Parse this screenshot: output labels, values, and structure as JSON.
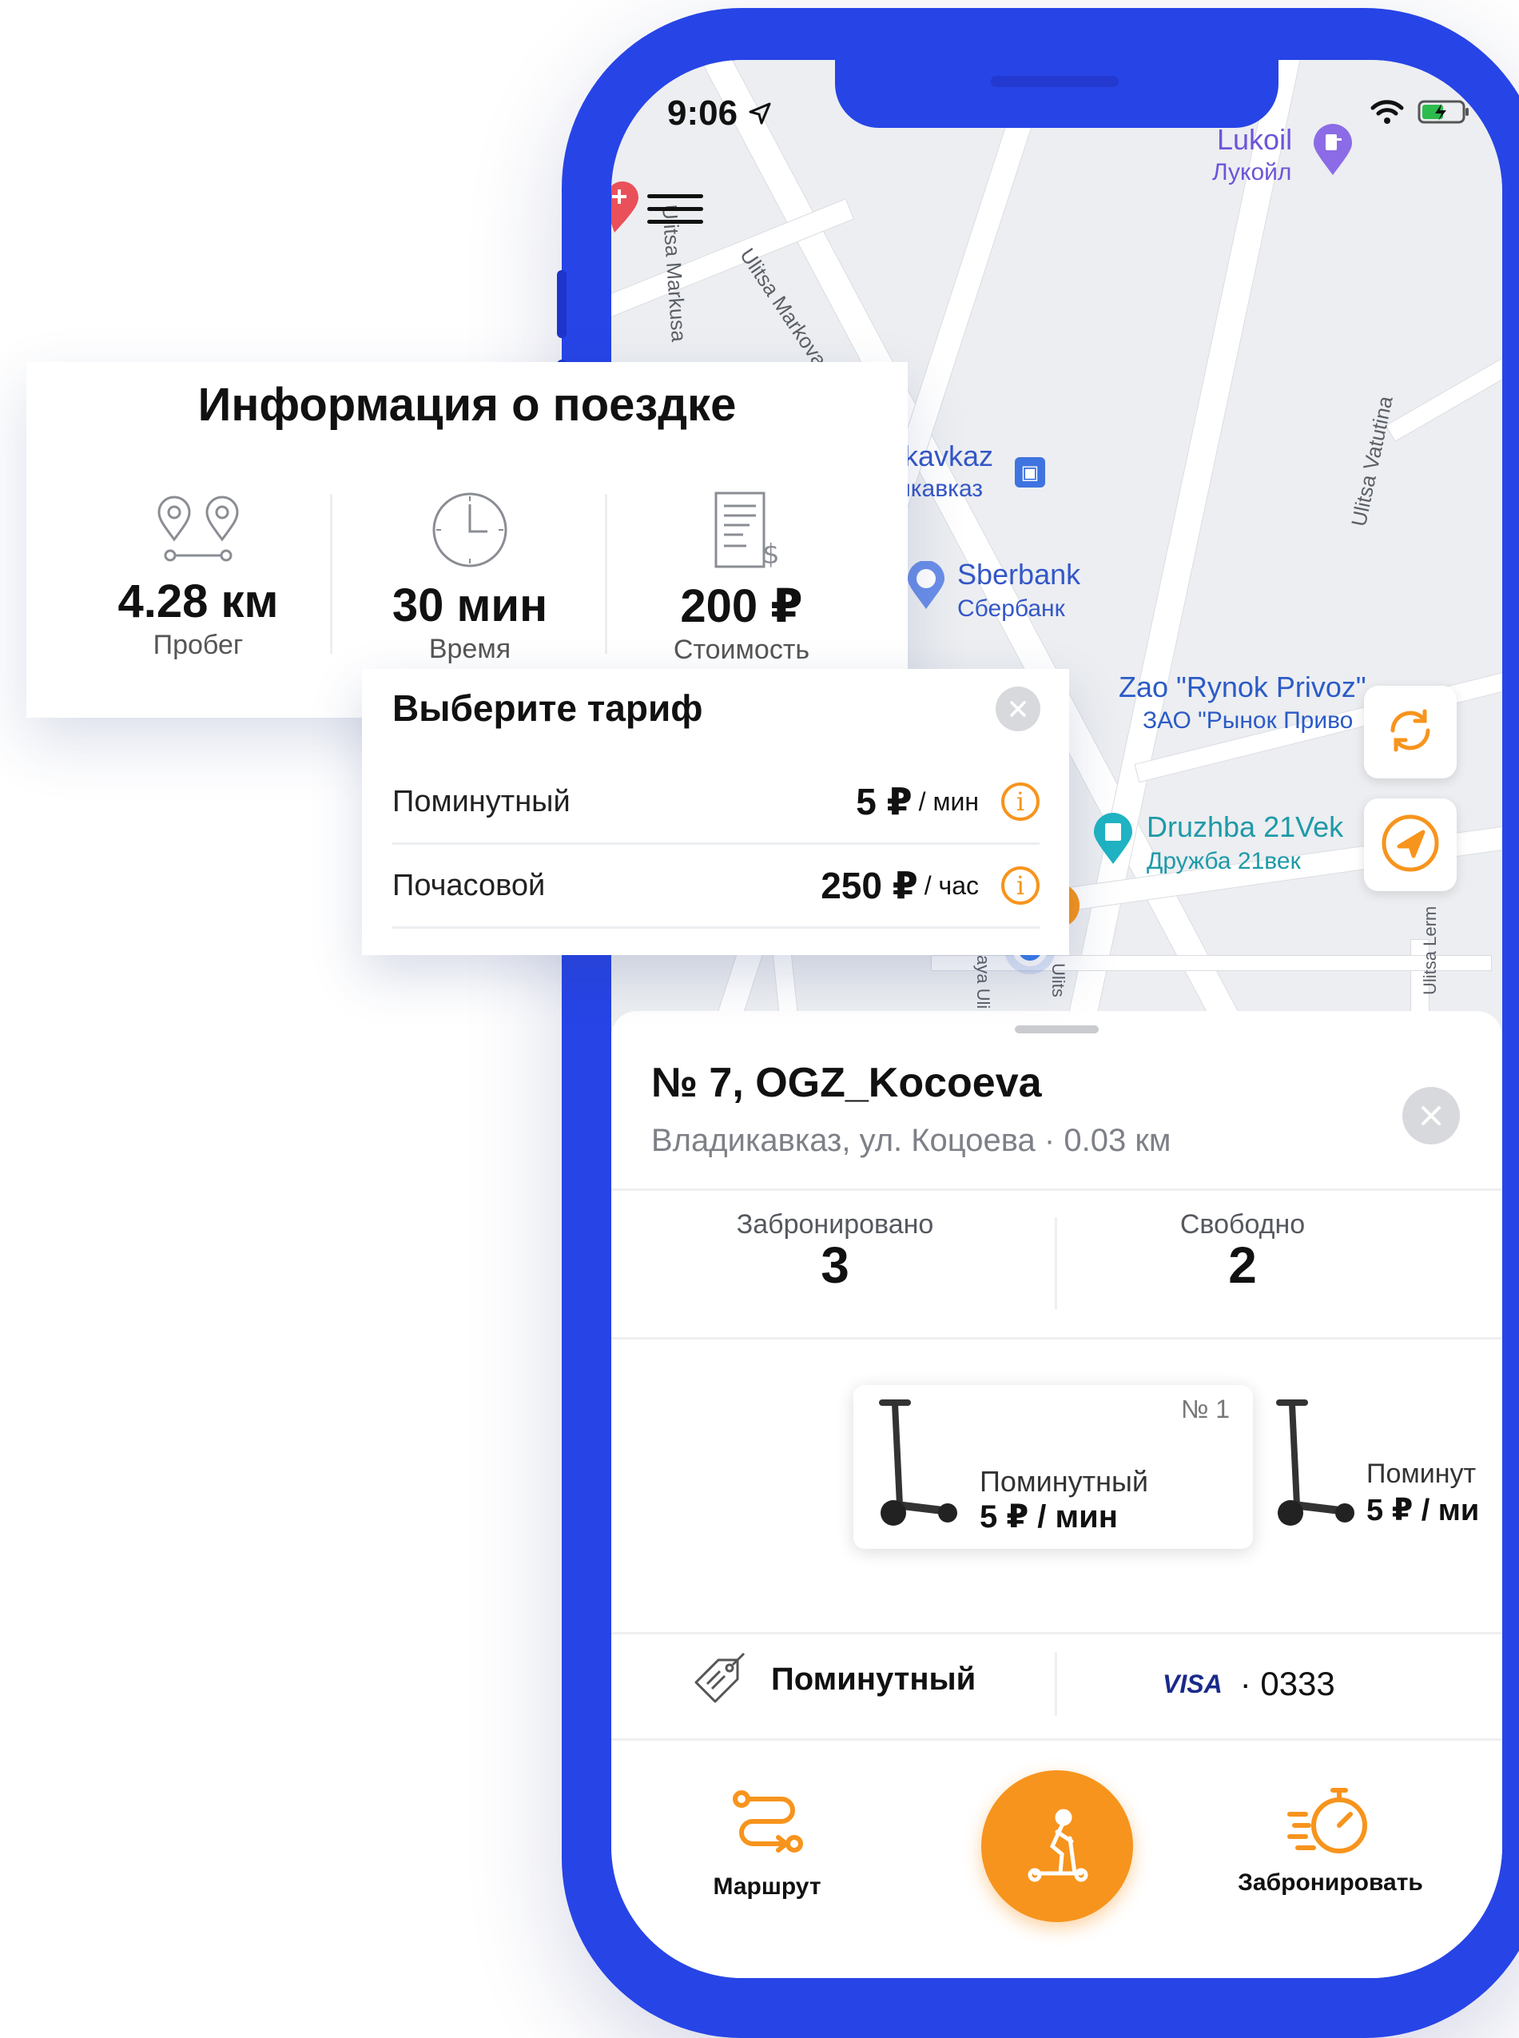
{
  "status_bar": {
    "time": "9:06"
  },
  "map": {
    "poi_lukoil": {
      "name": "Lukoil",
      "sub": "Лукойл"
    },
    "poi_vladikavkaz": {
      "name": "ikavkaz",
      "sub": "икавказ"
    },
    "poi_sberbank": {
      "name": "Sberbank",
      "sub": "Сбербанк"
    },
    "poi_rynok": {
      "name": "Zao \"Rynok Privoz\"",
      "sub": "ЗАО \"Рынок Приво"
    },
    "poi_druzhba": {
      "name": "Druzhba 21Vek",
      "sub": "Дружба 21век"
    },
    "streets": {
      "markova": "Ulitsa Markova",
      "markusa": "Ulitsa Markusa",
      "vatutina": "Ulitsa Vatutina",
      "lerm": "Ulitsa Lerm",
      "ulits": "Ulits",
      "aya_uli": "aya Uli"
    },
    "icons": [
      "menu-icon",
      "refresh-icon",
      "locate-icon",
      "fuel-icon",
      "bus-icon",
      "cinema-icon"
    ]
  },
  "station": {
    "title": "№ 7, OGZ_Kocoeva",
    "subtitle": "Владикавказ, ул. Коцоева · 0.03 км",
    "booked_label": "Забронировано",
    "booked_value": "3",
    "free_label": "Свободно",
    "free_value": "2",
    "scooters": [
      {
        "number": "№ 1",
        "tariff": "Поминутный",
        "price": "5 ₽ / мин"
      },
      {
        "number": "",
        "tariff": "Поминут",
        "price": "5 ₽ / ми"
      }
    ],
    "selected_tariff": "Поминутный",
    "card_brand": "VISA",
    "card_last4": "· 0333",
    "actions": {
      "route": "Маршрут",
      "book": "Забронировать"
    }
  },
  "trip_info": {
    "title": "Информация о поездке",
    "stats": [
      {
        "value": "4.28 км",
        "label": "Пробег",
        "icon": "route-pins-icon"
      },
      {
        "value": "30 мин",
        "label": "Время",
        "icon": "clock-icon"
      },
      {
        "value": "200 ₽",
        "label": "Стоимость",
        "icon": "receipt-icon"
      }
    ]
  },
  "tariff_picker": {
    "title": "Выберите тариф",
    "rows": [
      {
        "name": "Поминутный",
        "price": "5 ₽",
        "unit": "/ мин"
      },
      {
        "name": "Почасовой",
        "price": "250 ₽",
        "unit": "/ час"
      }
    ]
  },
  "colors": {
    "phone_frame": "#2744e6",
    "accent": "#f7941d",
    "map_bg": "#eceef1"
  }
}
